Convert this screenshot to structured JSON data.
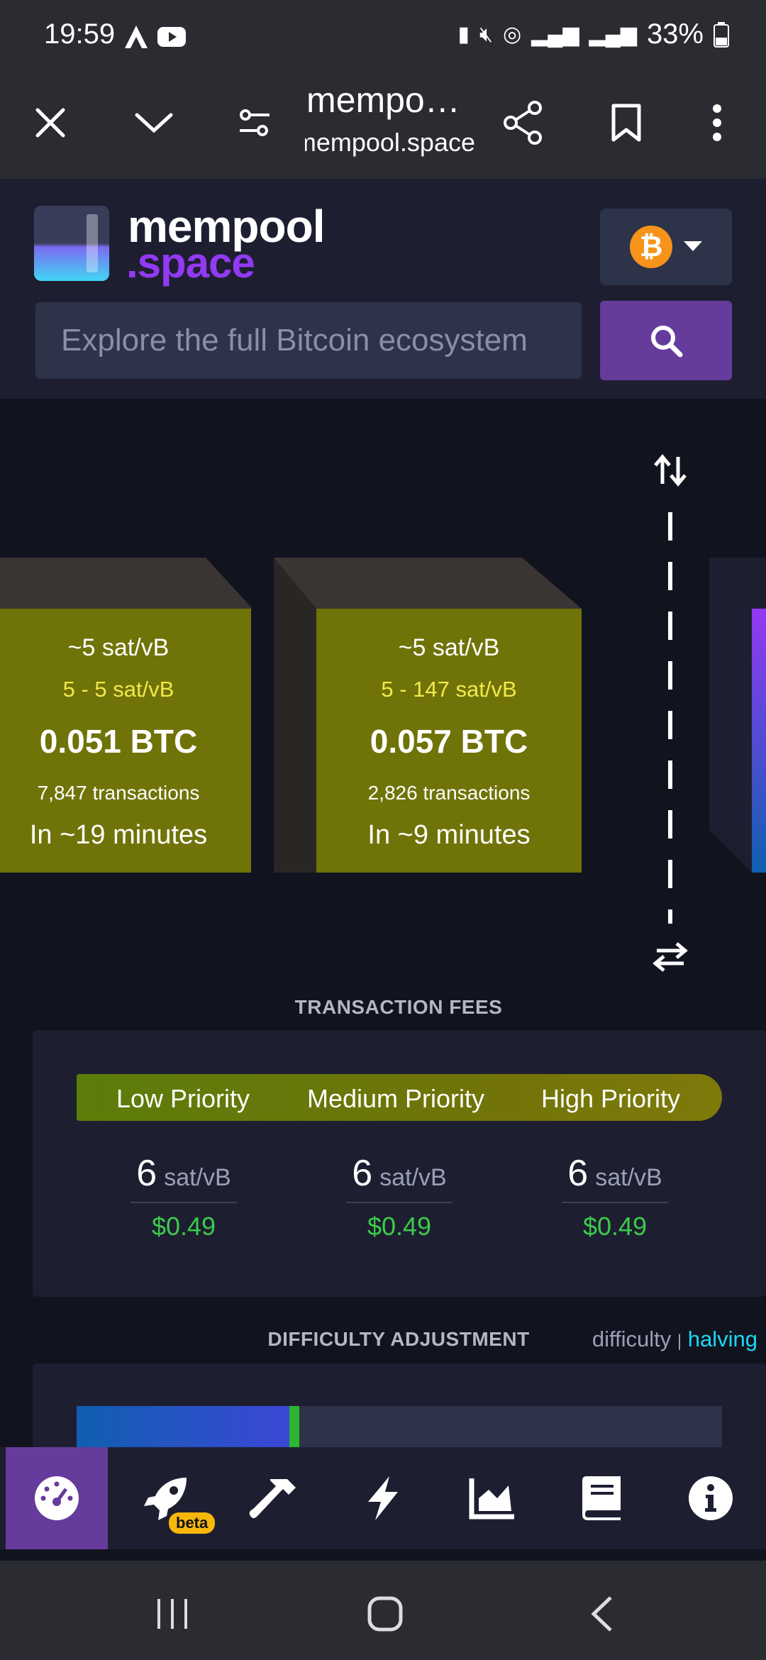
{
  "status_bar": {
    "time": "19:59",
    "battery": "33%"
  },
  "browser": {
    "page_title": "mempo…",
    "url": "mempool.space"
  },
  "site": {
    "logo_top": "mempool",
    "logo_bottom": ".space",
    "network_symbol": "₿",
    "search_placeholder": "Explore the full Bitcoin ecosystem"
  },
  "mempool_blocks": [
    {
      "median_fee": "~5 sat/vB",
      "fee_range": "5 - 5 sat/vB",
      "total": "0.051 BTC",
      "tx_count": "7,847 transactions",
      "eta": "In ~19 minutes"
    },
    {
      "median_fee": "~5 sat/vB",
      "fee_range": "5 - 147 sat/vB",
      "total": "0.057 BTC",
      "tx_count": "2,826 transactions",
      "eta": "In ~9 minutes"
    }
  ],
  "fees": {
    "title": "TRANSACTION FEES",
    "priorities": [
      {
        "label": "Low Priority",
        "value": "6",
        "unit": "sat/vB",
        "usd": "$0.49"
      },
      {
        "label": "Medium Priority",
        "value": "6",
        "unit": "sat/vB",
        "usd": "$0.49"
      },
      {
        "label": "High Priority",
        "value": "6",
        "unit": "sat/vB",
        "usd": "$0.49"
      }
    ]
  },
  "difficulty": {
    "title": "DIFFICULTY ADJUSTMENT",
    "link_difficulty": "difficulty",
    "separator": "|",
    "link_halving": "halving",
    "progress_fraction": 0.33
  },
  "bottom_nav": {
    "beta_badge": "beta",
    "items": [
      "dashboard-icon",
      "rocket-icon",
      "hammer-icon",
      "lightning-icon",
      "chart-icon",
      "docs-icon",
      "info-icon"
    ]
  },
  "colors": {
    "accent": "#653b9c",
    "block_front": "#707308",
    "fee_usd": "#3bcc49",
    "halving_link": "#1bd8f4",
    "btc_orange": "#f7931a"
  }
}
